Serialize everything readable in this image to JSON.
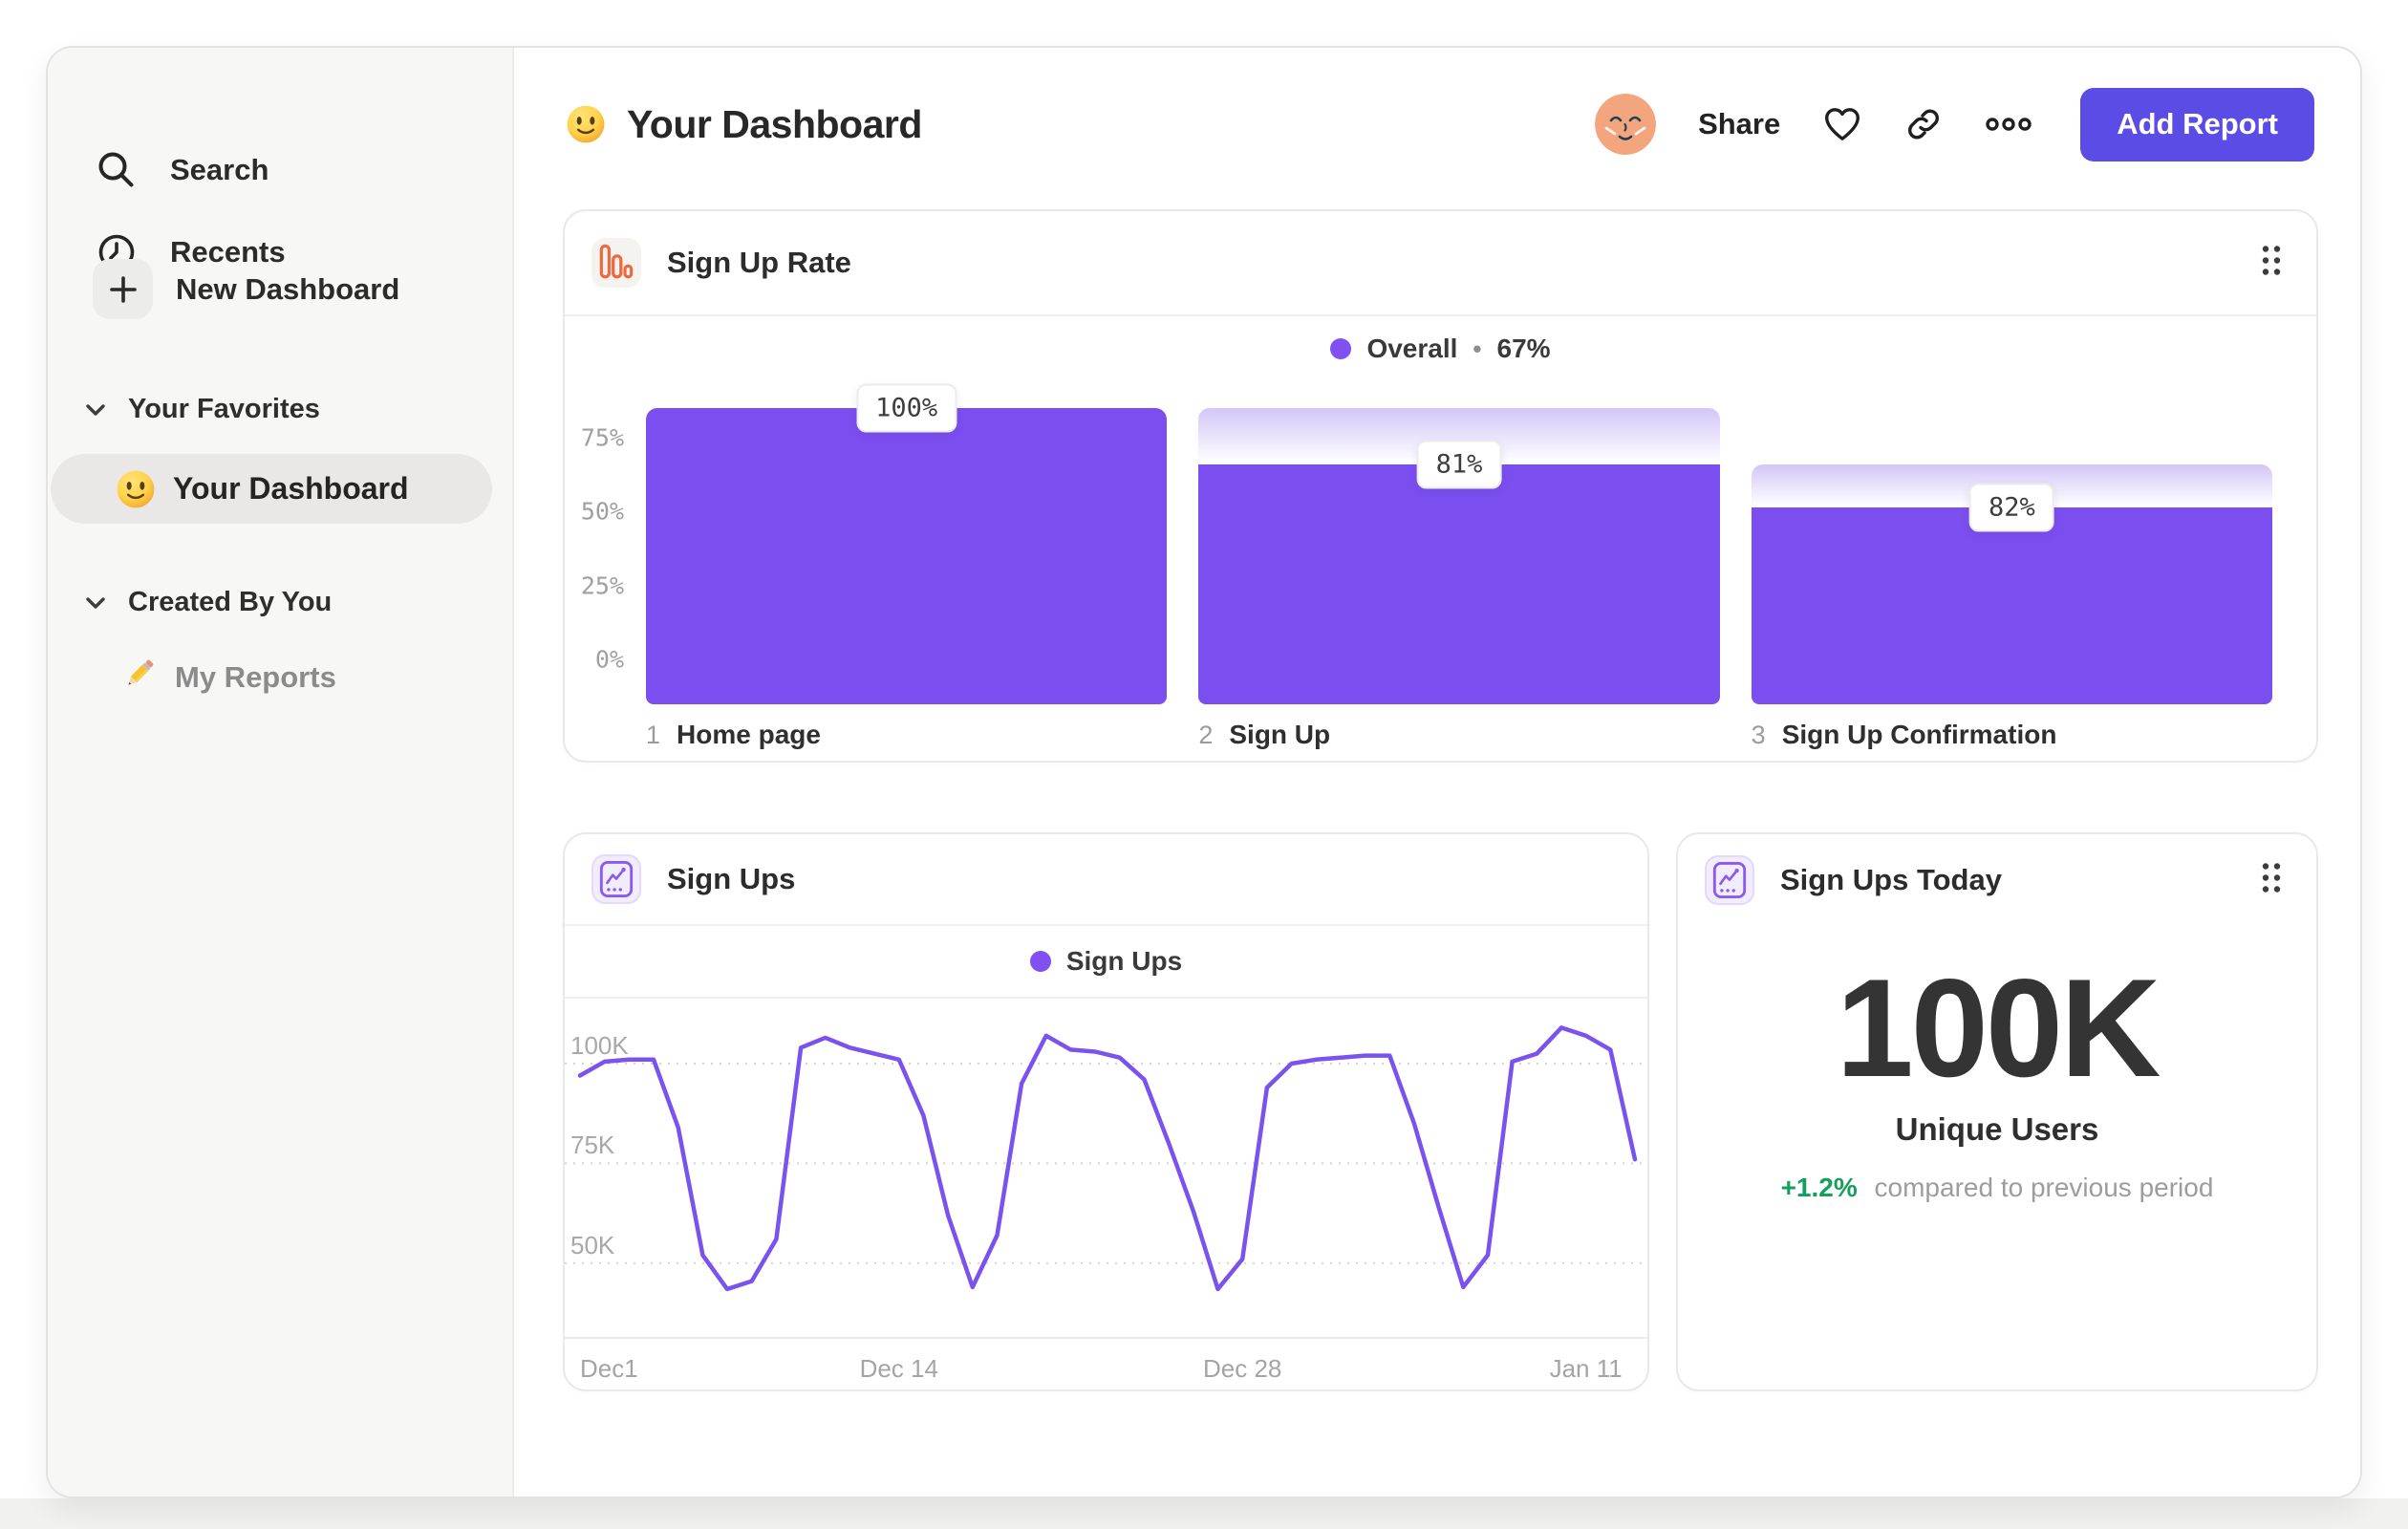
{
  "header": {
    "title": "Your Dashboard",
    "title_emoji": "slightly-smiling-face",
    "share_label": "Share",
    "add_report_label": "Add Report",
    "action_icons": [
      "avatar",
      "heart-icon",
      "link-icon",
      "ellipsis-icon"
    ],
    "add_report_color": "#5c4ce6"
  },
  "sidebar": {
    "items": [
      {
        "label": "Search",
        "icon": "search-icon"
      },
      {
        "label": "Recents",
        "icon": "clock-icon"
      },
      {
        "label": "New Dashboard",
        "icon": "plus-icon"
      }
    ],
    "sections": [
      {
        "label": "Your Favorites",
        "icon": "chevron-down-icon",
        "items": [
          {
            "label": "Your Dashboard",
            "icon": "slightly-smiling-face-emoji",
            "active": true
          }
        ]
      },
      {
        "label": "Created By You",
        "icon": "chevron-down-icon",
        "items": [
          {
            "label": "My Reports",
            "icon": "pencil-emoji",
            "active": false
          }
        ]
      }
    ]
  },
  "cards": {
    "funnel": {
      "title": "Sign Up Rate",
      "icon": "bar-chart-icon",
      "legend": {
        "label": "Overall",
        "separator": "•",
        "value": "67%"
      }
    },
    "line": {
      "title": "Sign Ups",
      "icon": "line-chart-icon",
      "legend_label": "Sign Ups"
    },
    "today": {
      "title": "Sign Ups Today",
      "icon": "line-chart-icon",
      "value": "100K",
      "caption": "Unique Users",
      "delta": "+1.2%",
      "delta_note": "compared to previous period"
    }
  },
  "colors": {
    "bar_purple": "#7b4ef0",
    "line_purple": "#7a52ed",
    "legend_dot": "#8050f2",
    "funnel_icon_orange": "#ed6a3f",
    "delta_green": "#14a05a"
  },
  "chart_data": [
    {
      "type": "bar",
      "subtype": "funnel",
      "title": "Sign Up Rate",
      "legend": "Overall",
      "overall_conversion": "67%",
      "ylim": [
        0,
        100
      ],
      "grid": false,
      "y_ticks": [
        {
          "label": "75%",
          "value": 75
        },
        {
          "label": "50%",
          "value": 50
        },
        {
          "label": "25%",
          "value": 25
        },
        {
          "label": "0%",
          "value": 0
        }
      ],
      "categories": [
        "Home page",
        "Sign Up",
        "Sign Up Confirmation"
      ],
      "values": [
        100,
        81,
        82
      ],
      "steps": [
        {
          "index": "1",
          "name": "Home page",
          "conversion_label": "100%",
          "step_conversion_pct": 100,
          "height_pct": 100,
          "carry_pct": 100
        },
        {
          "index": "2",
          "name": "Sign Up",
          "conversion_label": "81%",
          "step_conversion_pct": 81,
          "height_pct": 81,
          "carry_pct": 100
        },
        {
          "index": "3",
          "name": "Sign Up Confirmation",
          "conversion_label": "82%",
          "step_conversion_pct": 82,
          "height_pct": 66.4,
          "carry_pct": 81
        }
      ]
    },
    {
      "type": "line",
      "title": "Sign Ups",
      "legend": "Sign Ups",
      "ylabel": "",
      "xlabel": "",
      "ylim": [
        35,
        115
      ],
      "grid": "dashed-horizontal",
      "legend_position": "top-center",
      "y_ticks": [
        {
          "label": "100K",
          "value": 100
        },
        {
          "label": "75K",
          "value": 75
        },
        {
          "label": "50K",
          "value": 50
        }
      ],
      "x_ticks": [
        {
          "label": "Dec1",
          "day": 0,
          "align": "left"
        },
        {
          "label": "Dec 14",
          "day": 13
        },
        {
          "label": "Dec 28",
          "day": 27
        },
        {
          "label": "Jan 11",
          "day": 41
        }
      ],
      "x_unit": "day",
      "values_unit": "thousands of sign ups",
      "values": [
        97,
        100.5,
        101,
        101,
        84,
        52,
        43.5,
        45.5,
        56,
        104,
        106.5,
        104,
        102.5,
        101,
        87,
        62,
        44,
        57,
        95,
        107,
        103.5,
        103,
        101.5,
        96,
        80,
        63,
        43.5,
        51,
        94,
        100,
        101,
        101.5,
        102,
        102,
        85,
        64,
        44,
        52,
        100.5,
        102.5,
        109,
        107,
        103.5,
        76
      ]
    },
    {
      "type": "metric",
      "title": "Sign Ups Today",
      "value": "100K",
      "label": "Unique Users",
      "delta": "+1.2%",
      "delta_note": "compared to previous period"
    }
  ]
}
